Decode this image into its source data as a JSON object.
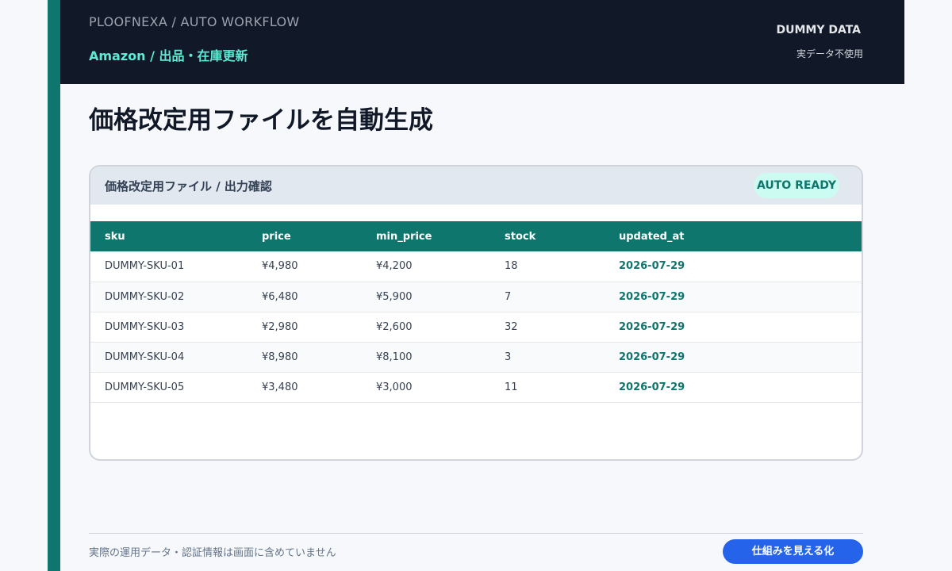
{
  "header": {
    "brand": "PLOOFNEXA / AUTO WORKFLOW",
    "product": "Amazon / 出品・在庫更新",
    "dummy_label": "DUMMY DATA",
    "dummy_sub": "実データ不使用"
  },
  "page_title": "価格改定用ファイルを自動生成",
  "card": {
    "title": "価格改定用ファイル / 出力確認",
    "badge": "AUTO READY",
    "columns": [
      "sku",
      "price",
      "min_price",
      "stock",
      "updated_at"
    ],
    "rows": [
      [
        "DUMMY-SKU-01",
        "¥4,980",
        "¥4,200",
        "18",
        "2026-07-29"
      ],
      [
        "DUMMY-SKU-02",
        "¥6,480",
        "¥5,900",
        "7",
        "2026-07-29"
      ],
      [
        "DUMMY-SKU-03",
        "¥2,980",
        "¥2,600",
        "32",
        "2026-07-29"
      ],
      [
        "DUMMY-SKU-04",
        "¥8,980",
        "¥8,100",
        "3",
        "2026-07-29"
      ],
      [
        "DUMMY-SKU-05",
        "¥3,480",
        "¥3,000",
        "11",
        "2026-07-29"
      ]
    ]
  },
  "footer": {
    "note": "実際の運用データ・認証情報は画面に含めていません",
    "cta": "仕組みを見える化"
  },
  "colors": {
    "accent": "#0f766e",
    "header_bg": "#111827",
    "highlight": "#5eead4",
    "cta": "#2563eb"
  }
}
